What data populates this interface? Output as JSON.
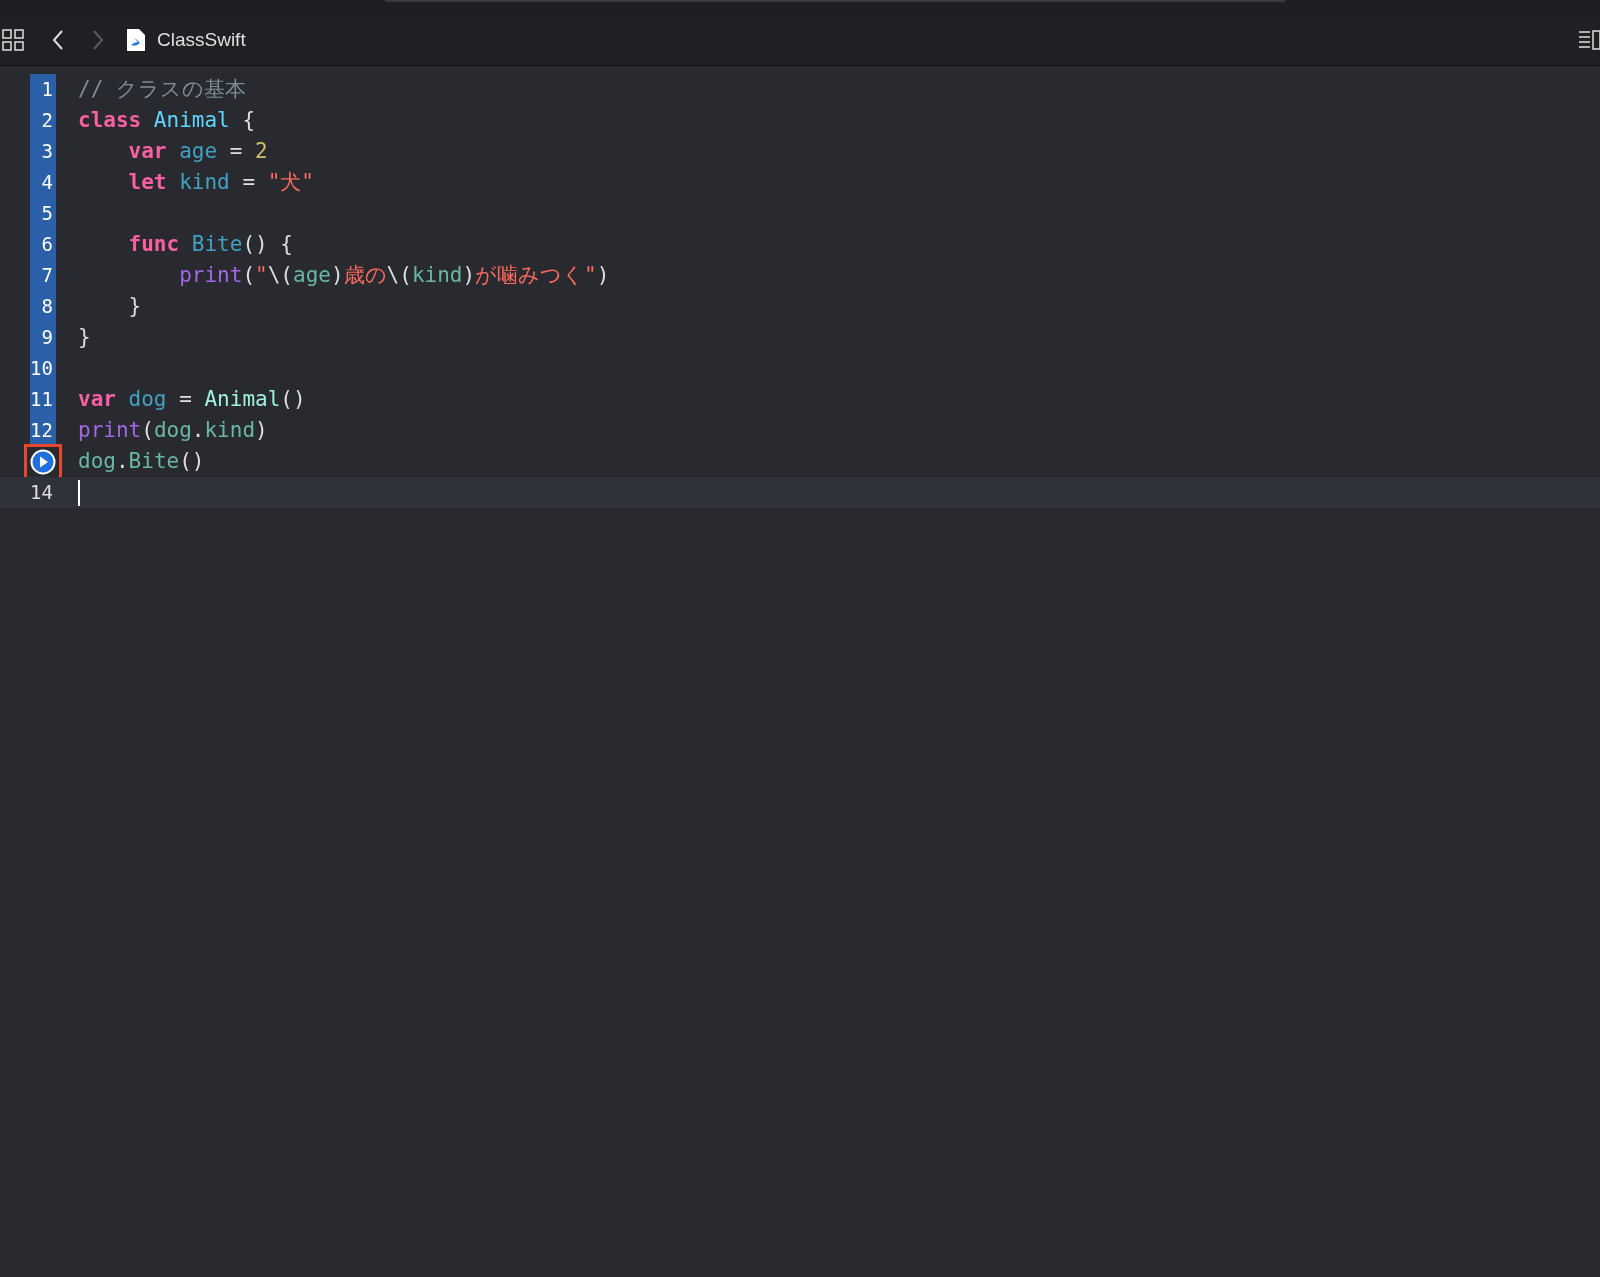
{
  "toolbar": {
    "title": "ClassSwift",
    "back_disabled": false,
    "forward_disabled": true
  },
  "lines": [
    {
      "kind": "number",
      "number": "1",
      "executed": true,
      "current": false,
      "tokens": [
        {
          "kind": "comment",
          "text": "// クラスの基本"
        }
      ]
    },
    {
      "kind": "number",
      "number": "2",
      "executed": true,
      "current": false,
      "tokens": [
        {
          "kind": "keyword",
          "text": "class"
        },
        {
          "kind": "type",
          "text": " Animal"
        },
        {
          "kind": "plain",
          "text": " {"
        }
      ]
    },
    {
      "kind": "number",
      "number": "3",
      "executed": true,
      "current": false,
      "tokens": [
        {
          "kind": "keyword",
          "text": "    var"
        },
        {
          "kind": "decl",
          "text": " age"
        },
        {
          "kind": "plain",
          "text": " ="
        },
        {
          "kind": "number",
          "text": " 2"
        }
      ]
    },
    {
      "kind": "number",
      "number": "4",
      "executed": true,
      "current": false,
      "tokens": [
        {
          "kind": "keyword",
          "text": "    let"
        },
        {
          "kind": "decl",
          "text": " kind"
        },
        {
          "kind": "plain",
          "text": " ="
        },
        {
          "kind": "string",
          "text": " \"犬\""
        }
      ]
    },
    {
      "kind": "number",
      "number": "5",
      "executed": true,
      "current": false
    },
    {
      "kind": "number",
      "number": "6",
      "executed": true,
      "current": false,
      "tokens": [
        {
          "kind": "keyword",
          "text": "    func"
        },
        {
          "kind": "decl",
          "text": " Bite"
        },
        {
          "kind": "plain",
          "text": "() {"
        }
      ]
    },
    {
      "kind": "number",
      "number": "7",
      "executed": true,
      "current": false,
      "tokens": [
        {
          "kind": "builtin",
          "text": "        print"
        },
        {
          "kind": "plain",
          "text": "("
        },
        {
          "kind": "string",
          "text": "\""
        },
        {
          "kind": "plain",
          "text": "\\("
        },
        {
          "kind": "ref",
          "text": "age"
        },
        {
          "kind": "plain",
          "text": ")"
        },
        {
          "kind": "string",
          "text": "歳の"
        },
        {
          "kind": "plain",
          "text": "\\("
        },
        {
          "kind": "ref",
          "text": "kind"
        },
        {
          "kind": "plain",
          "text": ")"
        },
        {
          "kind": "string",
          "text": "が噛みつく\""
        },
        {
          "kind": "plain",
          "text": ")"
        }
      ]
    },
    {
      "kind": "number",
      "number": "8",
      "executed": true,
      "current": false,
      "tokens": [
        {
          "kind": "plain",
          "text": "    }"
        }
      ]
    },
    {
      "kind": "number",
      "number": "9",
      "executed": true,
      "current": false,
      "tokens": [
        {
          "kind": "plain",
          "text": "}"
        }
      ]
    },
    {
      "kind": "number",
      "number": "10",
      "executed": true,
      "current": false
    },
    {
      "kind": "number",
      "number": "11",
      "executed": true,
      "current": false,
      "tokens": [
        {
          "kind": "keyword",
          "text": "var"
        },
        {
          "kind": "decl",
          "text": " dog"
        },
        {
          "kind": "plain",
          "text": " = "
        },
        {
          "kind": "typeref",
          "text": "Animal"
        },
        {
          "kind": "plain",
          "text": "()"
        }
      ]
    },
    {
      "kind": "number",
      "number": "12",
      "executed": true,
      "current": false,
      "tokens": [
        {
          "kind": "builtin",
          "text": "print"
        },
        {
          "kind": "plain",
          "text": "("
        },
        {
          "kind": "ref",
          "text": "dog"
        },
        {
          "kind": "plain",
          "text": "."
        },
        {
          "kind": "ref",
          "text": "kind"
        },
        {
          "kind": "plain",
          "text": ")"
        }
      ]
    },
    {
      "kind": "run",
      "current": false,
      "tokens": [
        {
          "kind": "ref",
          "text": "dog"
        },
        {
          "kind": "plain",
          "text": "."
        },
        {
          "kind": "ref",
          "text": "Bite"
        },
        {
          "kind": "plain",
          "text": "()"
        }
      ]
    },
    {
      "kind": "number",
      "number": "14",
      "executed": false,
      "current": true
    }
  ]
}
